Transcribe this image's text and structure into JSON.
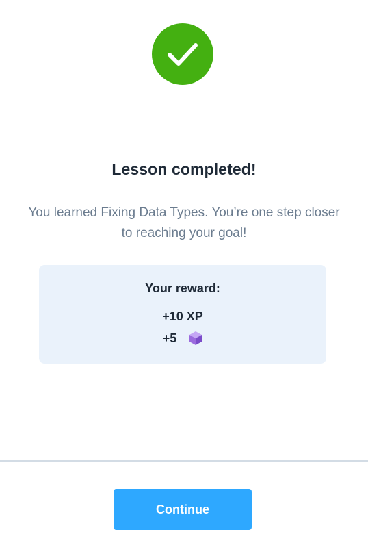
{
  "dialog": {
    "icon": "checkmark-circle-icon",
    "title": "Lesson completed!",
    "message": "You learned Fixing Data Types. You’re one step closer to reaching your goal!"
  },
  "reward": {
    "title": "Your reward:",
    "xp": "+10 XP",
    "gems": "+5",
    "gem_icon": "gem-cube-icon"
  },
  "footer": {
    "continue_label": "Continue"
  },
  "colors": {
    "success": "#44b011",
    "primary_button": "#2ea8ff",
    "reward_card": "#eaf2fb",
    "gem": "#9b6bde"
  }
}
